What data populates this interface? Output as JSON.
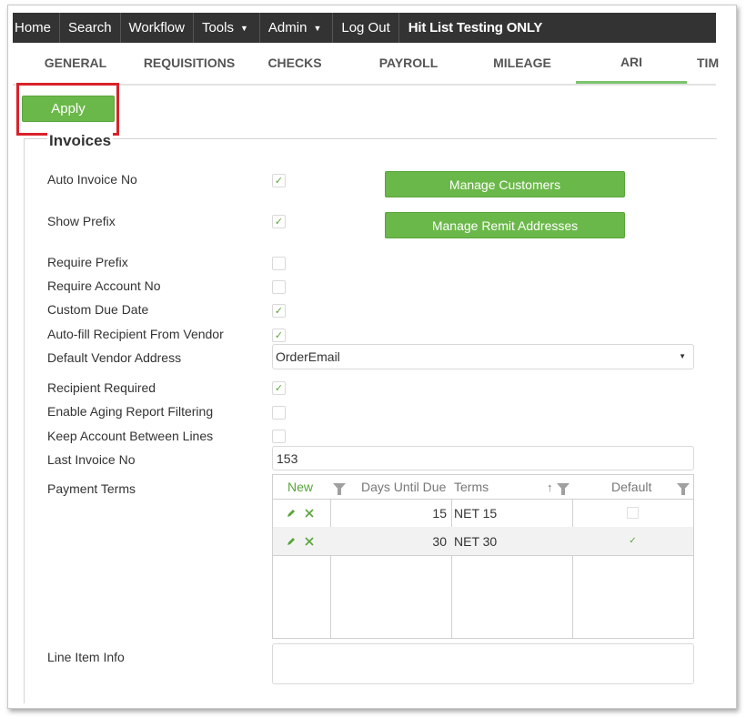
{
  "nav": {
    "items": [
      {
        "label": "Home"
      },
      {
        "label": "Search"
      },
      {
        "label": "Workflow"
      },
      {
        "label": "Tools",
        "caret": "▼"
      },
      {
        "label": "Admin",
        "caret": "▼"
      },
      {
        "label": "Log Out"
      }
    ],
    "site_title": "Hit List Testing ONLY"
  },
  "tabs": [
    {
      "label": "GENERAL"
    },
    {
      "label": "REQUISITIONS"
    },
    {
      "label": "CHECKS"
    },
    {
      "label": "PAYROLL"
    },
    {
      "label": "MILEAGE"
    },
    {
      "label": "ARI",
      "active": true
    },
    {
      "label": "TIM"
    }
  ],
  "apply_label": "Apply",
  "section_title": "Invoices",
  "fields": {
    "auto_invoice_no": {
      "label": "Auto Invoice No",
      "checked": true
    },
    "show_prefix": {
      "label": "Show Prefix",
      "checked": true
    },
    "require_prefix": {
      "label": "Require Prefix",
      "checked": false
    },
    "require_account_no": {
      "label": "Require Account No",
      "checked": false
    },
    "custom_due_date": {
      "label": "Custom Due Date",
      "checked": true
    },
    "autofill_recipient": {
      "label": "Auto-fill Recipient From Vendor",
      "checked": true
    },
    "default_vendor_address": {
      "label": "Default Vendor Address",
      "value": "OrderEmail",
      "arrow": "▼"
    },
    "recipient_required": {
      "label": "Recipient Required",
      "checked": true
    },
    "enable_aging": {
      "label": "Enable Aging Report Filtering",
      "checked": false
    },
    "keep_account": {
      "label": "Keep Account Between Lines",
      "checked": false
    },
    "last_invoice_no": {
      "label": "Last Invoice No",
      "value": "153"
    },
    "payment_terms": {
      "label": "Payment Terms"
    },
    "line_item_info": {
      "label": "Line Item Info",
      "value": ""
    }
  },
  "buttons": {
    "manage_customers": "Manage Customers",
    "manage_remit": "Manage Remit Addresses"
  },
  "terms_grid": {
    "headers": {
      "new": "New",
      "days": "Days Until Due",
      "terms": "Terms",
      "default": "Default",
      "sort_arrow": "↑"
    },
    "rows": [
      {
        "days": "15",
        "terms": "NET 15",
        "default": false
      },
      {
        "days": "30",
        "terms": "NET 30",
        "default": true
      }
    ],
    "edit_icon": "pencil-icon",
    "delete_icon": "x-icon"
  },
  "colors": {
    "accent_green": "#6bb84a",
    "nav_bg": "#333333",
    "highlight_red": "#d9222a"
  },
  "check_glyph": "✓"
}
